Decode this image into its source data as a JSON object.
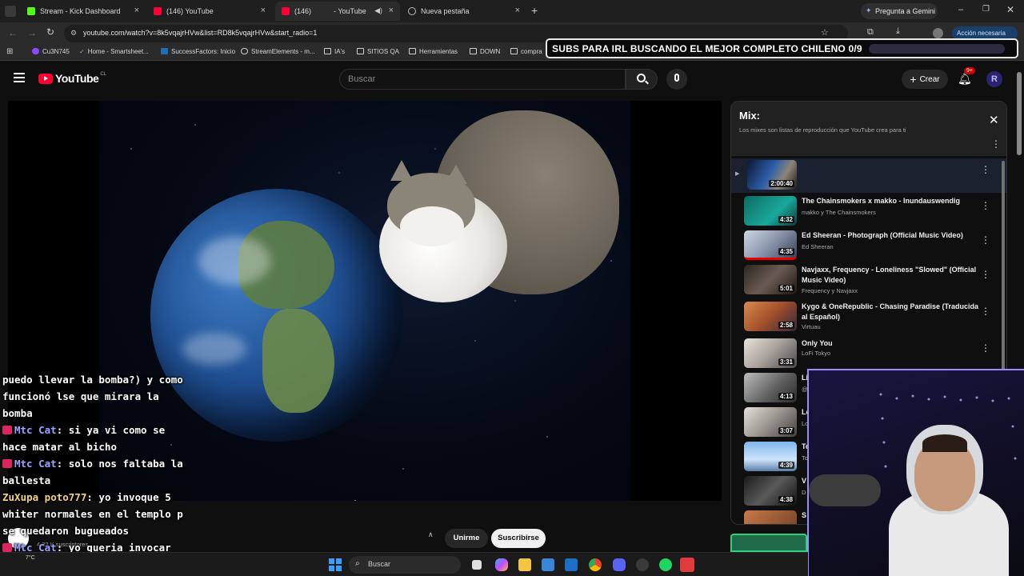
{
  "browser": {
    "tabs": [
      {
        "label": "Stream - Kick Dashboard",
        "active": false
      },
      {
        "label": "(146) YouTube",
        "active": false
      },
      {
        "label": "(146)",
        "label_suffix": "- YouTube",
        "active": true
      },
      {
        "label": "Nueva pestaña",
        "active": false
      }
    ],
    "gemini_label": "Pregunta a Gemini",
    "url": "youtube.com/watch?v=8k5vqajrHVw&list=RD8k5vqajrHVw&start_radio=1",
    "action_required": "Acción necesaria",
    "bookmarks": [
      "Cu3N745",
      "Home - Smartsheet...",
      "SuccessFactors: Inicio",
      "StreamElements - m...",
      "IA's",
      "SITIOS QA",
      "Herramientas",
      "DOWN",
      "compra"
    ]
  },
  "overlay": {
    "subs_goal": "SUBS PARA IRL BUSCANDO EL MEJOR COMPLETO CHILENO 0/9",
    "progress": 0
  },
  "youtube": {
    "logo": "YouTube",
    "country": "CL",
    "search_placeholder": "Buscar",
    "create_label": "Crear",
    "notifications_badge": "9+",
    "unirme_label": "Unirme",
    "subscribe_label": "Suscribirse",
    "subscribers": "4,32 K suscriptores"
  },
  "mix": {
    "title": "Mix:",
    "subtitle": "Los mixes son listas de reproducción que YouTube crea para ti",
    "items": [
      {
        "title": "",
        "channel": "",
        "duration": "2:00:40"
      },
      {
        "title": "The Chainsmokers x makko - Inundauswendig",
        "channel": "makko y The Chainsmokers",
        "duration": "4:32"
      },
      {
        "title": "Ed Sheeran - Photograph (Official Music Video)",
        "channel": "Ed Sheeran",
        "duration": "4:35"
      },
      {
        "title": "Navjaxx, Frequency - Loneliness \"Slowed\" (Official Music Video)",
        "channel": "Frequency y Navjaxx",
        "duration": "5:01"
      },
      {
        "title": "Kygo & OneRepublic - Chasing Paradise (Traducida al Español)",
        "channel": "Virtuau",
        "duration": "2:58"
      },
      {
        "title": "Only You",
        "channel": "LoFi Tokyo",
        "duration": "3:31"
      },
      {
        "title": "Li",
        "channel": "@",
        "duration": "4:13"
      },
      {
        "title": "Lo",
        "channel": "Lo",
        "duration": "3:07"
      },
      {
        "title": "To",
        "channel": "To",
        "duration": "4:39"
      },
      {
        "title": "V",
        "channel": "D",
        "duration": "4:38"
      },
      {
        "title": "S",
        "channel": "",
        "duration": ""
      }
    ]
  },
  "chat": {
    "lines": [
      {
        "user": "",
        "text": "puedo llevar la bomba?) y como funcionó lse que mirara la bomba"
      },
      {
        "user": "Mtc Cat",
        "text": "si ya vi como se hace matar al bicho"
      },
      {
        "user": "Mtc Cat",
        "text": "solo nos faltaba la ballesta"
      },
      {
        "user": "ZuXupa poto777",
        "text": "yo invoque 5 whiter normales en el templo p se quedaron bugueados"
      },
      {
        "user": "Mtc Cat",
        "text": "yo queria invocar los wither de metal"
      }
    ]
  },
  "taskbar": {
    "search_placeholder": "Buscar",
    "weather": "7°C"
  }
}
